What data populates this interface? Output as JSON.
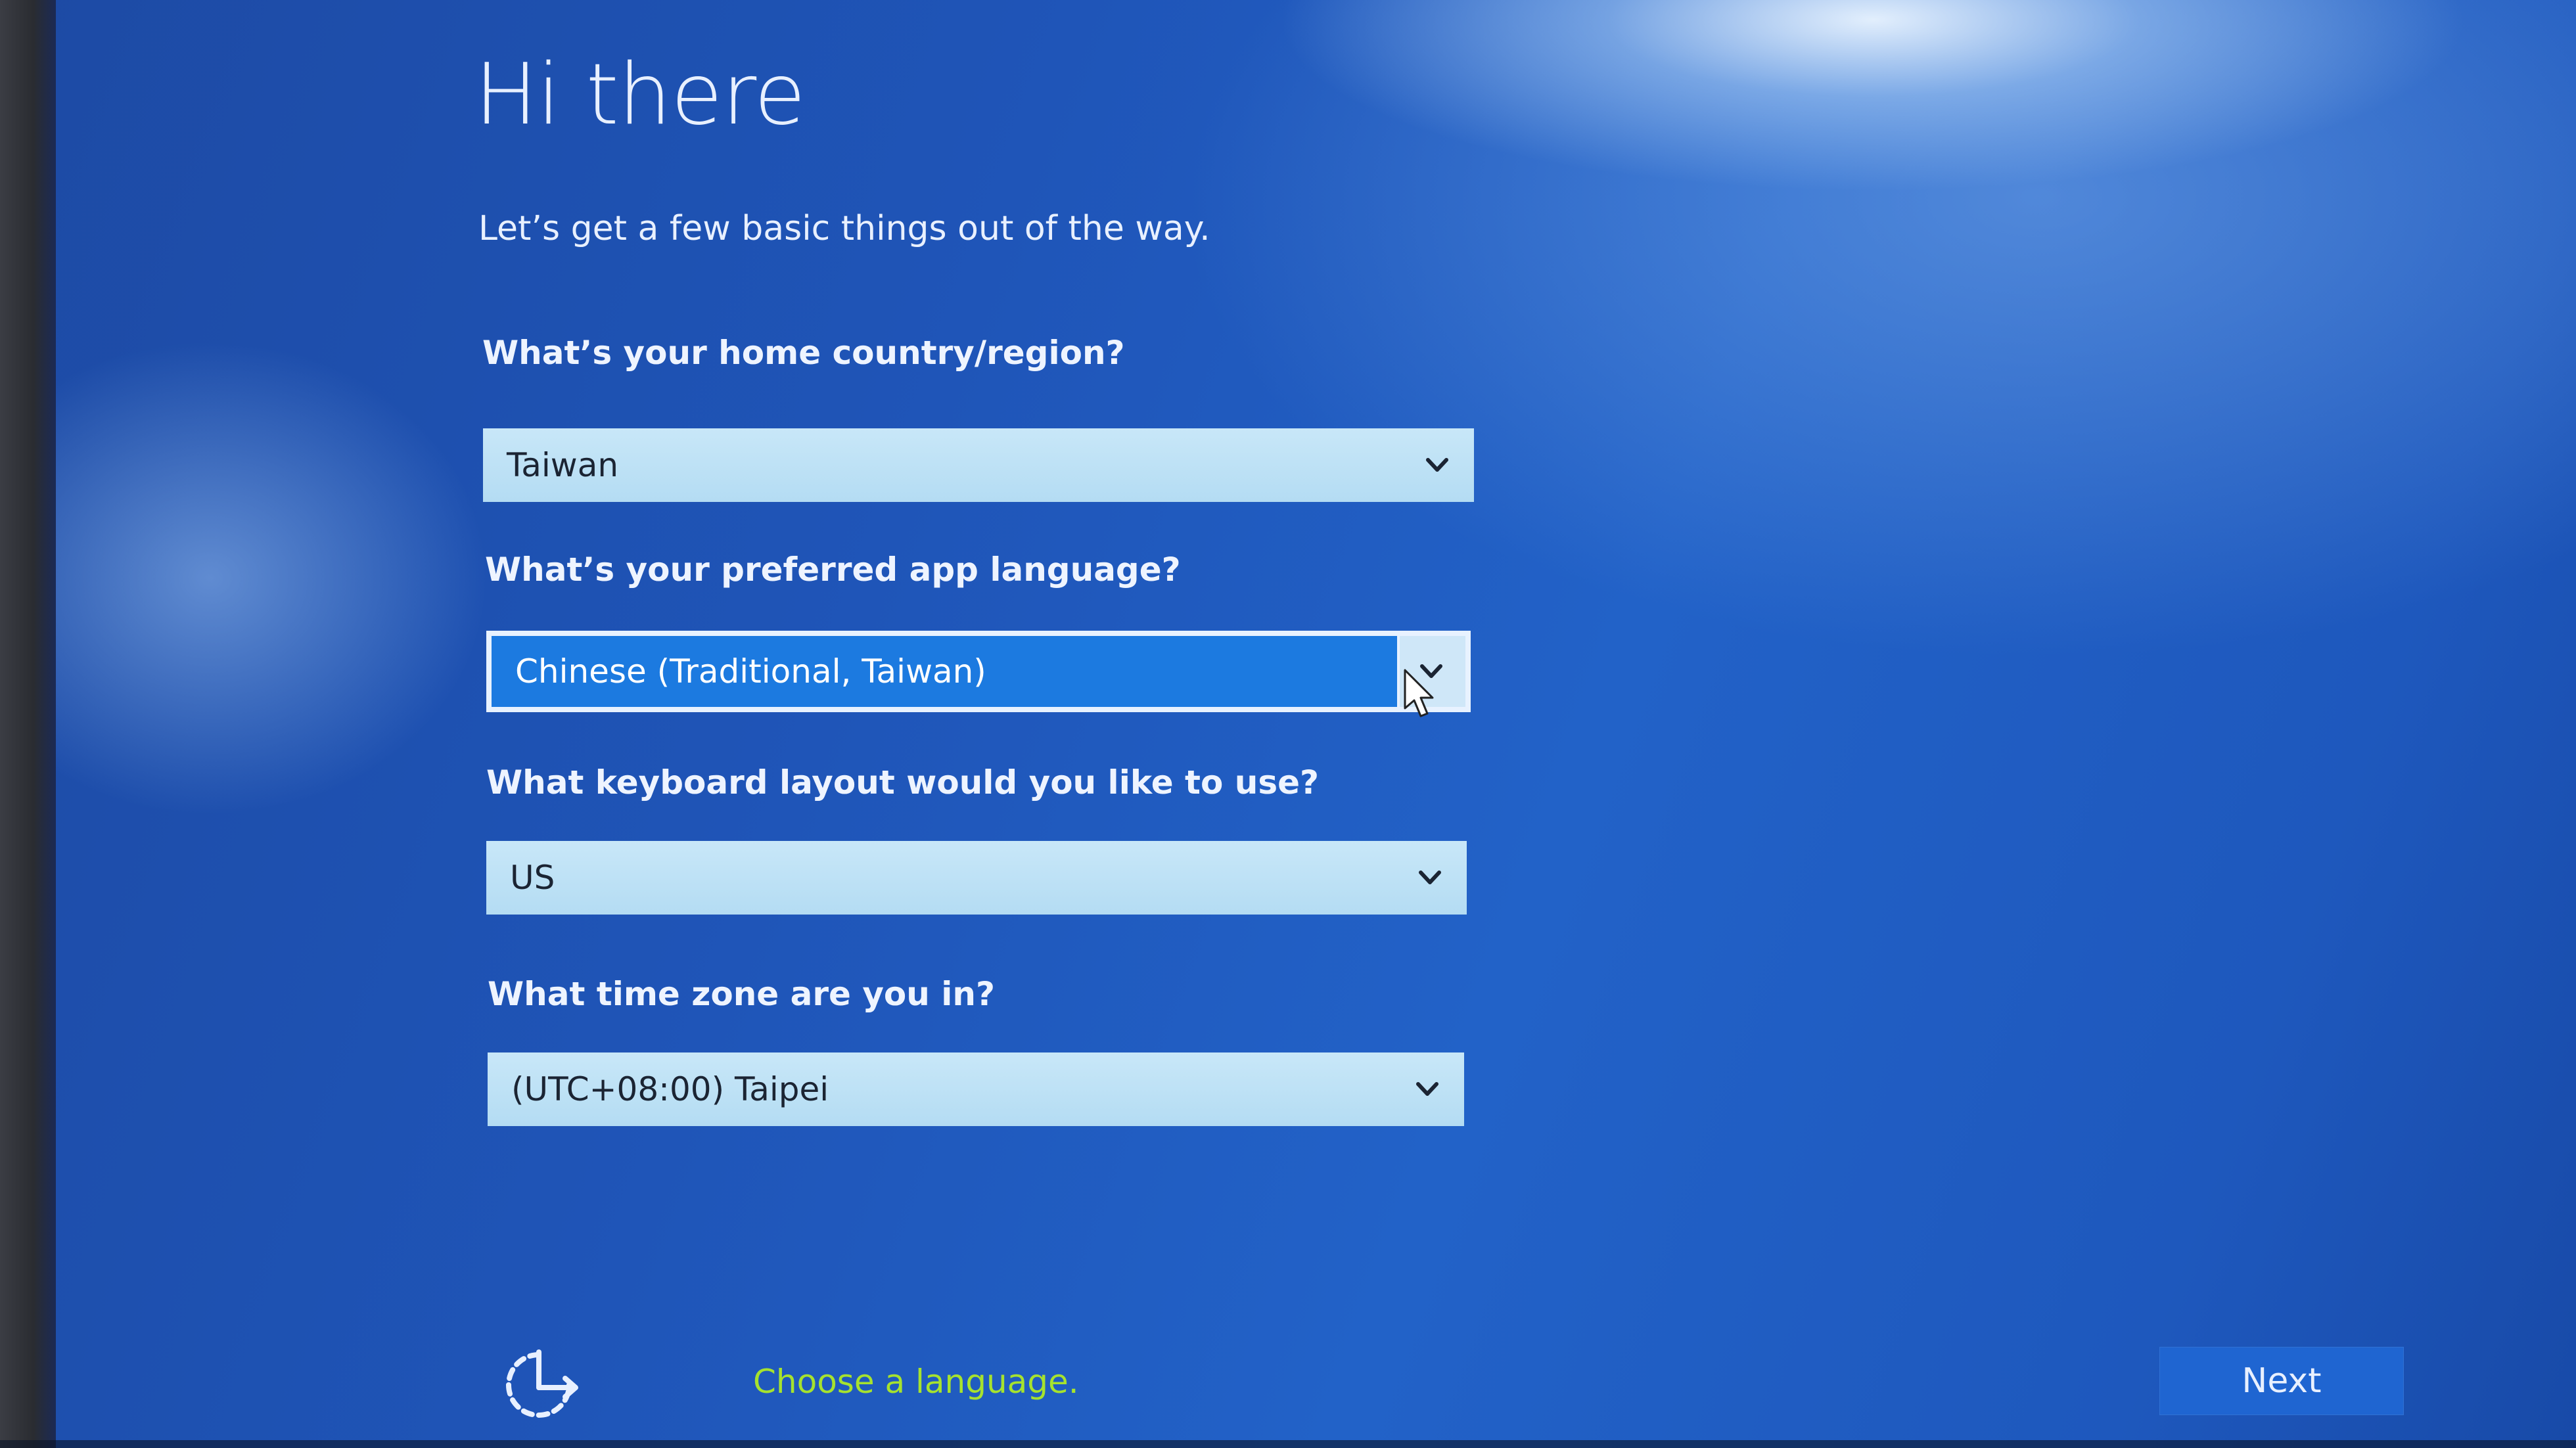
{
  "setup": {
    "title": "Hi there",
    "subtitle": "Let’s get a few basic things out of the way."
  },
  "fields": {
    "country": {
      "label": "What’s your home country/region?",
      "value": "Taiwan"
    },
    "app_language": {
      "label": "What’s your preferred app language?",
      "value": "Chinese (Traditional, Taiwan)"
    },
    "keyboard": {
      "label": "What keyboard layout would you like to use?",
      "value": "US"
    },
    "timezone": {
      "label": "What time zone are you in?",
      "value": "(UTC+08:00) Taipei"
    }
  },
  "footer": {
    "language_link": "Choose a language.",
    "next_label": "Next"
  },
  "icons": {
    "accessibility": "ease-of-access-icon",
    "dropdown": "chevron-down-icon",
    "pointer": "mouse-cursor-icon"
  },
  "colors": {
    "background": "#1f55b8",
    "dropdown_fill": "#c8e7f8",
    "dropdown_selected": "#1c7ae0",
    "link": "#a6e22e",
    "next_button": "#1f65d1"
  }
}
